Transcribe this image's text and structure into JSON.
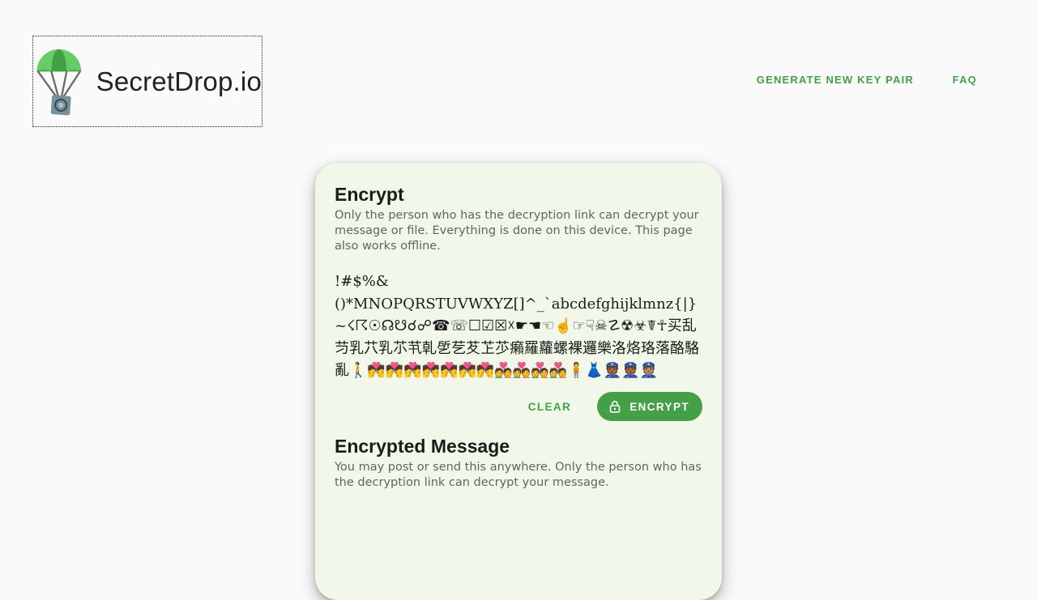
{
  "header": {
    "brand_name": "SecretDrop.io",
    "logo_icon": "parachute-icon",
    "nav": [
      {
        "label": "GENERATE NEW KEY PAIR"
      },
      {
        "label": "FAQ"
      }
    ]
  },
  "encrypt": {
    "title": "Encrypt",
    "description": "Only the person who has the decryption link can decrypt your message or file. Everything is done on this device. This page also works offline.",
    "message_value": "!#$%&\n()*MNOPQRSTUVWXYZ[]^_`abcdefghijklmnz{|}~☇☈☉☊☋☌☍☎☏☐☑☒☓☛☚☜☝☞☟☠☡☢☣☤☥买乱䒒乳䒔乳䒕䒖乹乺䒗䒘䒙䒚癩羅蘿螺裸邏樂洛烙珞落酪駱亂🚶💏💏💏💏💏💏💏💑💑💑💑🧍👗👮🏾👮🏾👮🏽",
    "clear_label": "CLEAR",
    "encrypt_label": "ENCRYPT",
    "encrypt_icon": "lock-icon"
  },
  "encrypted": {
    "title": "Encrypted Message",
    "description": "You may post or send this anywhere. Only the person who has the decryption link can decrypt your message."
  },
  "colors": {
    "accent": "#43a047",
    "card_background": "#f1f8e9",
    "page_background": "#fafafa"
  }
}
